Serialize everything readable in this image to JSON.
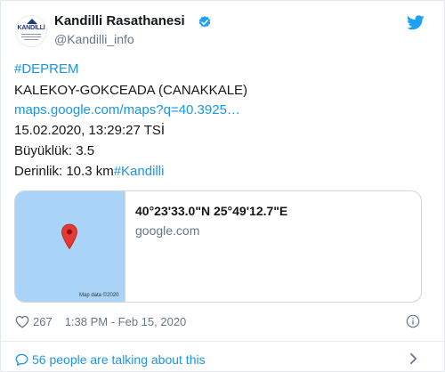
{
  "account": {
    "display_name": "Kandilli Rasathanesi",
    "handle": "@Kandilli_info",
    "avatar_text": "KANDİLLİ"
  },
  "tweet": {
    "hashtag_deprem": "#DEPREM",
    "location": "KALEKOY-GOKCEADA (CANAKKALE)",
    "maps_link": "maps.google.com/maps?q=40.3925…",
    "datetime": "15.02.2020, 13:29:27 TSİ",
    "magnitude": "Büyüklük: 3.5",
    "depth": "Derinlik: 10.3 km",
    "hashtag_kandilli": "#Kandilli"
  },
  "link_card": {
    "title": "40°23'33.0\"N 25°49'12.7\"E",
    "domain": "google.com",
    "map_credit": "Map data ©2020"
  },
  "footer": {
    "likes": "267",
    "timestamp": "1:38 PM - Feb 15, 2020",
    "talking": "56 people are talking about this"
  },
  "colors": {
    "link_blue": "#1b95e0",
    "twitter_blue": "#1da1f2",
    "map_water": "#a9d3f7",
    "pin_red": "#e53935"
  },
  "icons": [
    "verified-badge-icon",
    "twitter-bird-icon",
    "map-pin-icon",
    "heart-icon",
    "info-icon",
    "comment-bubble-icon",
    "chevron-right-icon"
  ]
}
